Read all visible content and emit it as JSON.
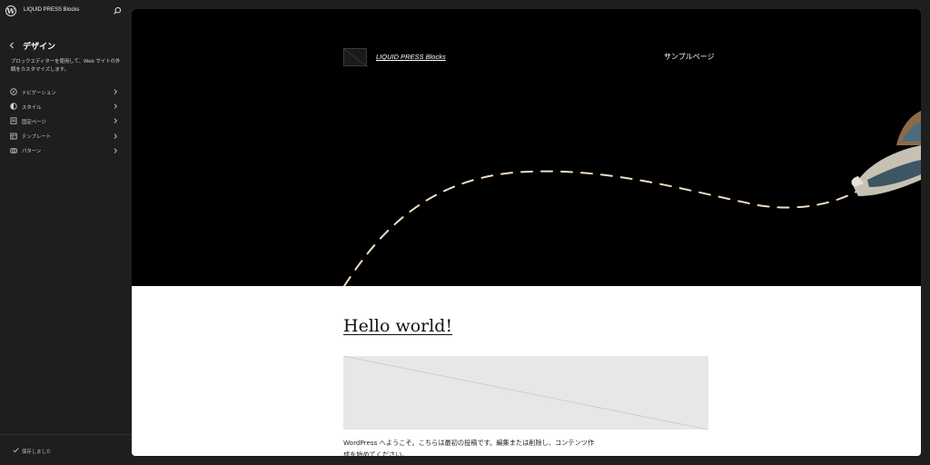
{
  "topbar": {
    "site_title": "LIQUID PRESS Blocks"
  },
  "panel": {
    "title": "デザイン",
    "description": "ブロックエディターを使用して、Web サイトの外観をカスタマイズします。"
  },
  "nav": {
    "items": [
      {
        "label": "ナビゲーション",
        "icon": "navigation-icon"
      },
      {
        "label": "スタイル",
        "icon": "styles-icon"
      },
      {
        "label": "固定ページ",
        "icon": "pages-icon"
      },
      {
        "label": "テンプレート",
        "icon": "template-icon"
      },
      {
        "label": "パターン",
        "icon": "patterns-icon"
      }
    ]
  },
  "footer": {
    "saved_label": "保存しました"
  },
  "site": {
    "title": "LIQUID PRESS Blocks",
    "nav_link": "サンプルページ"
  },
  "post": {
    "title": "Hello world!",
    "excerpt": "WordPress へようこそ。こちらは最初の投稿です。編集または削除し、コンテンツ作成を始めてください。"
  },
  "colors": {
    "sidebar_bg": "#1e1e1e",
    "hero_bg": "#000000",
    "dashed_path": "#f3dcc0",
    "placeholder_bg": "#e7e7e7"
  }
}
